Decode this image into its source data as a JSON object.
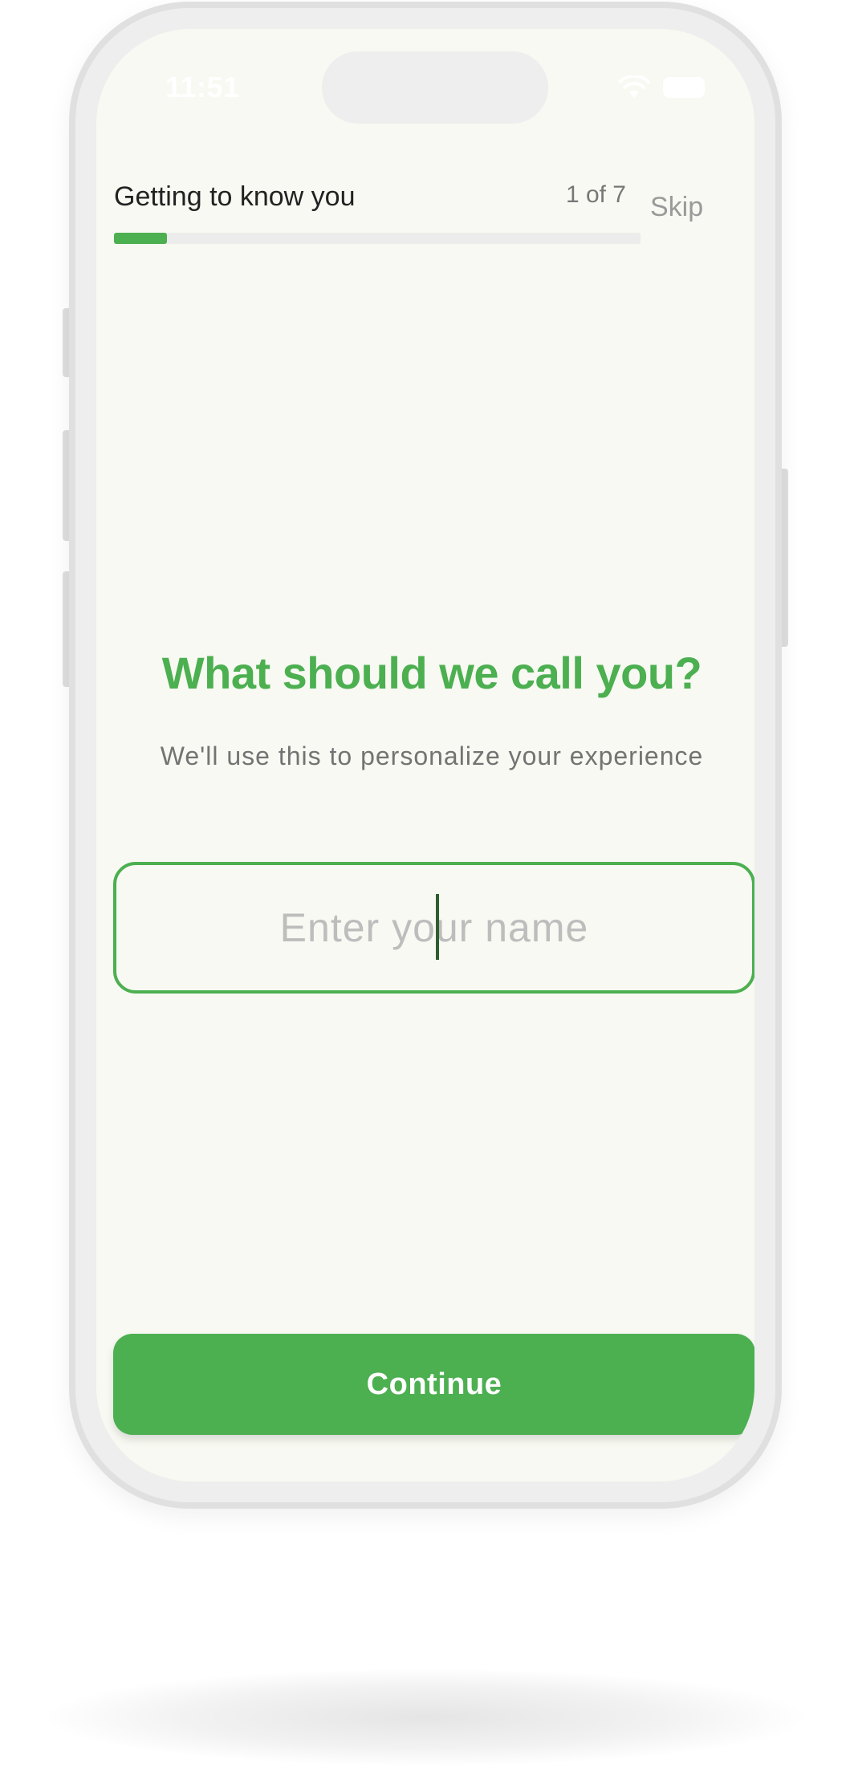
{
  "status_bar": {
    "time": "11:51",
    "icons": [
      "wifi-icon",
      "battery-icon"
    ]
  },
  "header": {
    "title": "Getting to know you",
    "step": "1 of 7",
    "skip_label": "Skip",
    "progress": 0.1
  },
  "main": {
    "question": "What should we call you?",
    "subtitle": "We'll use this to personalize your experience",
    "name_field": {
      "value": "",
      "placeholder": "Enter your name"
    },
    "continue_label": "Continue"
  },
  "colors": {
    "accent": "#4caf50",
    "screen_background": "#f7f9f2",
    "muted_text": "#777777",
    "placeholder": "#bdbdbd"
  }
}
